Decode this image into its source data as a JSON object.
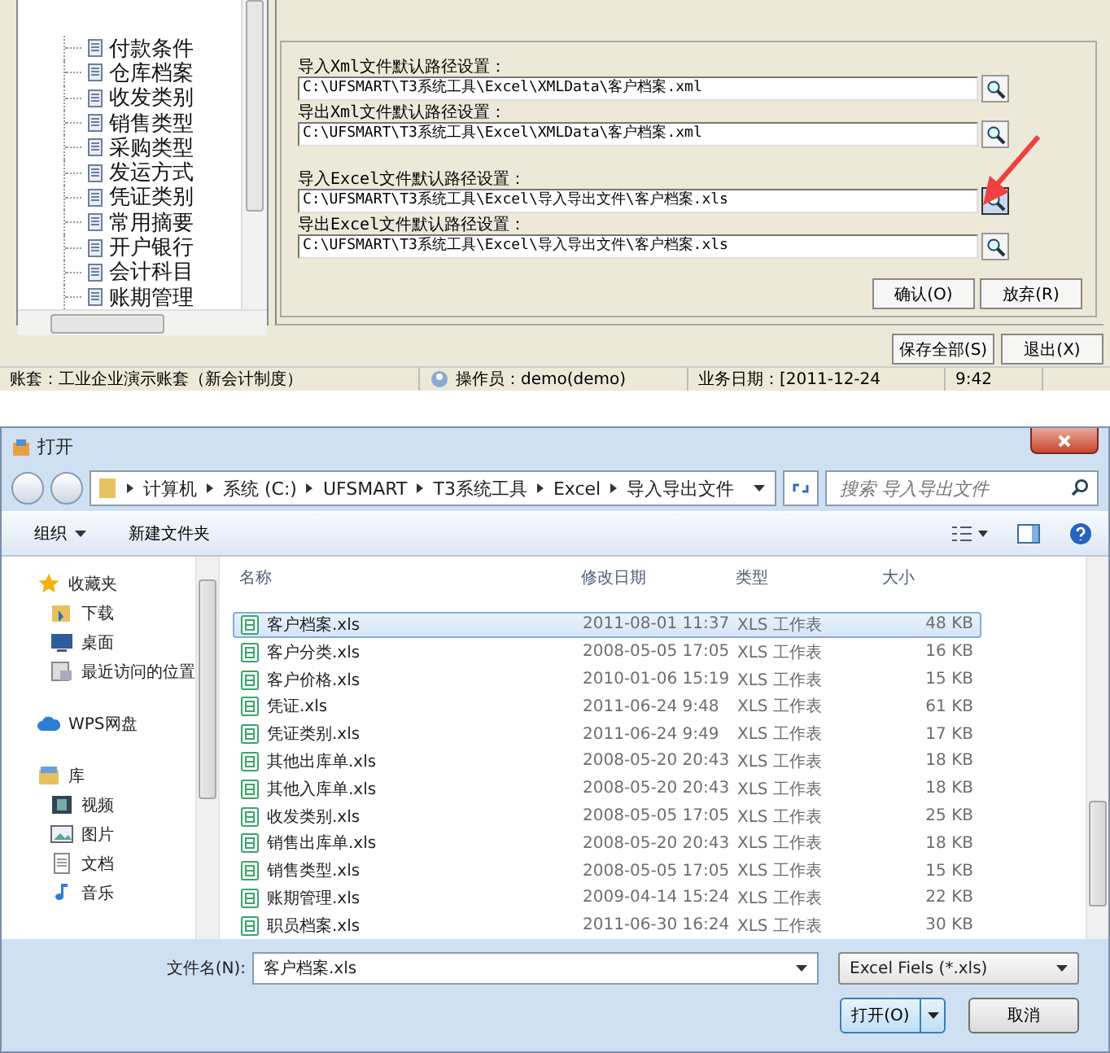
{
  "app": {
    "tree_items": [
      "付款条件",
      "仓库档案",
      "收发类别",
      "销售类型",
      "采购类型",
      "发运方式",
      "凭证类别",
      "常用摘要",
      "开户银行",
      "会计科目",
      "账期管理"
    ],
    "path_settings": [
      {
        "label": "导入Xml文件默认路径设置：",
        "value": "C:\\UFSMART\\T3系统工具\\Excel\\XMLData\\客户档案.xml",
        "pressed": false
      },
      {
        "label": "导出Xml文件默认路径设置：",
        "value": "C:\\UFSMART\\T3系统工具\\Excel\\XMLData\\客户档案.xml",
        "pressed": false
      },
      {
        "label": "导入Excel文件默认路径设置：",
        "value": "C:\\UFSMART\\T3系统工具\\Excel\\导入导出文件\\客户档案.xls",
        "pressed": true
      },
      {
        "label": "导出Excel文件默认路径设置：",
        "value": "C:\\UFSMART\\T3系统工具\\Excel\\导入导出文件\\客户档案.xls",
        "pressed": false
      }
    ],
    "dialog_buttons": [
      "确认(O)",
      "放弃(R)"
    ],
    "footer_buttons": [
      "保存全部(S)",
      "退出(X)"
    ],
    "status_bar": {
      "account": "账套：工业企业演示账套（新会计制度）",
      "operator": "操作员：demo(demo)",
      "date": "业务日期：[2011-12-24",
      "time": "9:42"
    }
  },
  "open_dialog": {
    "title": "打开",
    "breadcrumbs": [
      "计算机",
      "系统 (C:)",
      "UFSMART",
      "T3系统工具",
      "Excel",
      "导入导出文件"
    ],
    "search": {
      "placeholder": "搜索 导入导出文件"
    },
    "toolbar": {
      "organize": "组织",
      "new_folder": "新建文件夹"
    },
    "nav": [
      {
        "label": "收藏夹",
        "kind": "star",
        "children": [
          {
            "label": "下载",
            "kind": "folder"
          },
          {
            "label": "桌面",
            "kind": "desktop"
          },
          {
            "label": "最近访问的位置",
            "kind": "recent"
          }
        ]
      },
      {
        "label": "WPS网盘",
        "kind": "cloud"
      },
      {
        "label": "库",
        "kind": "library",
        "children": [
          {
            "label": "视频",
            "kind": "video"
          },
          {
            "label": "图片",
            "kind": "picture"
          },
          {
            "label": "文档",
            "kind": "document"
          },
          {
            "label": "音乐",
            "kind": "music"
          }
        ]
      }
    ],
    "columns": [
      "名称",
      "修改日期",
      "类型",
      "大小"
    ],
    "rows": [
      {
        "name": "客户档案.xls",
        "date": "2011-08-01 11:37",
        "type": "XLS 工作表",
        "size": "48 KB",
        "selected": true
      },
      {
        "name": "客户分类.xls",
        "date": "2008-05-05 17:05",
        "type": "XLS 工作表",
        "size": "16 KB",
        "selected": false
      },
      {
        "name": "客户价格.xls",
        "date": "2010-01-06 15:19",
        "type": "XLS 工作表",
        "size": "15 KB",
        "selected": false
      },
      {
        "name": "凭证.xls",
        "date": "2011-06-24 9:48",
        "type": "XLS 工作表",
        "size": "61 KB",
        "selected": false
      },
      {
        "name": "凭证类别.xls",
        "date": "2011-06-24 9:49",
        "type": "XLS 工作表",
        "size": "17 KB",
        "selected": false
      },
      {
        "name": "其他出库单.xls",
        "date": "2008-05-20 20:43",
        "type": "XLS 工作表",
        "size": "18 KB",
        "selected": false
      },
      {
        "name": "其他入库单.xls",
        "date": "2008-05-20 20:43",
        "type": "XLS 工作表",
        "size": "18 KB",
        "selected": false
      },
      {
        "name": "收发类别.xls",
        "date": "2008-05-05 17:05",
        "type": "XLS 工作表",
        "size": "25 KB",
        "selected": false
      },
      {
        "name": "销售出库单.xls",
        "date": "2008-05-20 20:43",
        "type": "XLS 工作表",
        "size": "18 KB",
        "selected": false
      },
      {
        "name": "销售类型.xls",
        "date": "2008-05-05 17:05",
        "type": "XLS 工作表",
        "size": "15 KB",
        "selected": false
      },
      {
        "name": "账期管理.xls",
        "date": "2009-04-14 15:24",
        "type": "XLS 工作表",
        "size": "22 KB",
        "selected": false
      },
      {
        "name": "职员档案.xls",
        "date": "2011-06-30 16:24",
        "type": "XLS 工作表",
        "size": "30 KB",
        "selected": false
      }
    ],
    "filename": {
      "label": "文件名(N):",
      "value": "客户档案.xls"
    },
    "filter": "Excel Fiels (*.xls)",
    "open_button": "打开(O)",
    "cancel_button": "取消"
  }
}
